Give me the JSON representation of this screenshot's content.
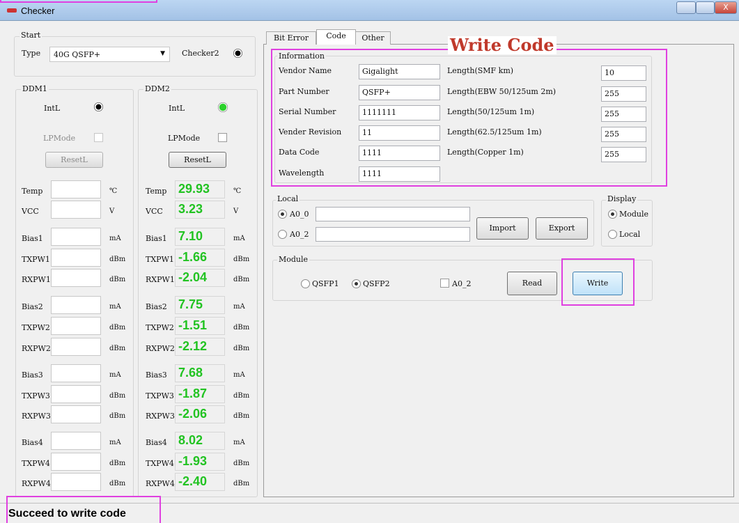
{
  "window": {
    "title": "Checker",
    "close_glyph": "X"
  },
  "start": {
    "group_label": "Start",
    "type_label": "Type",
    "type_value": "40G QSFP+",
    "checker_label": "Checker2"
  },
  "ddm1": {
    "label": "DDM1",
    "intl": "IntL",
    "lpmode": "LPMode",
    "reset": "ResetL",
    "rows": [
      {
        "label": "Temp",
        "unit": "℃",
        "value": ""
      },
      {
        "label": "VCC",
        "unit": "V",
        "value": ""
      },
      {
        "label": "Bias1",
        "unit": "mA",
        "value": ""
      },
      {
        "label": "TXPW1",
        "unit": "dBm",
        "value": ""
      },
      {
        "label": "RXPW1",
        "unit": "dBm",
        "value": ""
      },
      {
        "label": "Bias2",
        "unit": "mA",
        "value": ""
      },
      {
        "label": "TXPW2",
        "unit": "dBm",
        "value": ""
      },
      {
        "label": "RXPW2",
        "unit": "dBm",
        "value": ""
      },
      {
        "label": "Bias3",
        "unit": "mA",
        "value": ""
      },
      {
        "label": "TXPW3",
        "unit": "dBm",
        "value": ""
      },
      {
        "label": "RXPW3",
        "unit": "dBm",
        "value": ""
      },
      {
        "label": "Bias4",
        "unit": "mA",
        "value": ""
      },
      {
        "label": "TXPW4",
        "unit": "dBm",
        "value": ""
      },
      {
        "label": "RXPW4",
        "unit": "dBm",
        "value": ""
      }
    ]
  },
  "ddm2": {
    "label": "DDM2",
    "intl": "IntL",
    "lpmode": "LPMode",
    "reset": "ResetL",
    "rows": [
      {
        "label": "Temp",
        "unit": "℃",
        "value": "29.93"
      },
      {
        "label": "VCC",
        "unit": "V",
        "value": "3.23"
      },
      {
        "label": "Bias1",
        "unit": "mA",
        "value": "7.10"
      },
      {
        "label": "TXPW1",
        "unit": "dBm",
        "value": "-1.66"
      },
      {
        "label": "RXPW1",
        "unit": "dBm",
        "value": "-2.04"
      },
      {
        "label": "Bias2",
        "unit": "mA",
        "value": "7.75"
      },
      {
        "label": "TXPW2",
        "unit": "dBm",
        "value": "-1.51"
      },
      {
        "label": "RXPW2",
        "unit": "dBm",
        "value": "-2.12"
      },
      {
        "label": "Bias3",
        "unit": "mA",
        "value": "7.68"
      },
      {
        "label": "TXPW3",
        "unit": "dBm",
        "value": "-1.87"
      },
      {
        "label": "RXPW3",
        "unit": "dBm",
        "value": "-2.06"
      },
      {
        "label": "Bias4",
        "unit": "mA",
        "value": "8.02"
      },
      {
        "label": "TXPW4",
        "unit": "dBm",
        "value": "-1.93"
      },
      {
        "label": "RXPW4",
        "unit": "dBm",
        "value": "-2.40"
      }
    ]
  },
  "tabs": [
    "Bit Error",
    "Code",
    "Other"
  ],
  "heading": "Write Code",
  "information": {
    "label": "Information",
    "left": [
      {
        "label": "Vendor Name",
        "value": "Gigalight"
      },
      {
        "label": "Part Number",
        "value": "QSFP+"
      },
      {
        "label": "Serial Number",
        "value": "1111111"
      },
      {
        "label": "Vender Revision",
        "value": "11"
      },
      {
        "label": "Data Code",
        "value": "1111"
      },
      {
        "label": "Wavelength",
        "value": "1111"
      }
    ],
    "right": [
      {
        "label": "Length(SMF km)",
        "value": "10"
      },
      {
        "label": "Length(EBW 50/125um 2m)",
        "value": "255"
      },
      {
        "label": "Length(50/125um 1m)",
        "value": "255"
      },
      {
        "label": "Length(62.5/125um 1m)",
        "value": "255"
      },
      {
        "label": "Length(Copper 1m)",
        "value": "255"
      }
    ]
  },
  "local": {
    "label": "Local",
    "a0": "A0_0",
    "a2": "A0_2",
    "import": "Import",
    "export": "Export"
  },
  "display": {
    "label": "Display",
    "module": "Module",
    "local": "Local"
  },
  "module": {
    "label": "Module",
    "qsfp1": "QSFP1",
    "qsfp2": "QSFP2",
    "a0_2": "A0_2",
    "read": "Read",
    "write": "Write"
  },
  "status": "Succeed to write code",
  "colors": {
    "accent_green": "#22c322",
    "highlight_magenta": "#e040e0",
    "heading_red": "#c0392b"
  }
}
